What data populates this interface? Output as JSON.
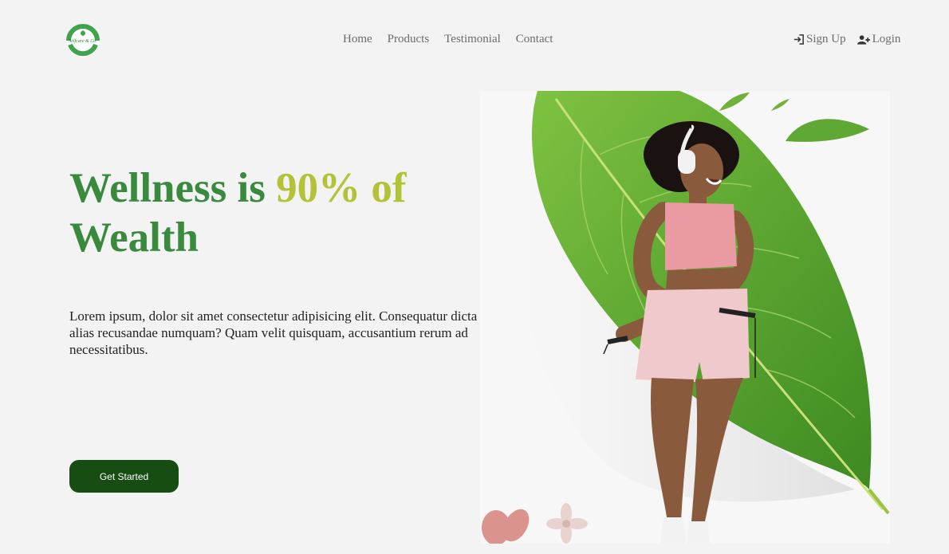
{
  "brand": {
    "logo_text": "Selfcare & Co.",
    "logo_icon": "leaf-badge-icon",
    "color_primary": "#3a8a3e",
    "color_accent": "#b3c236",
    "color_button": "#174d12"
  },
  "nav": {
    "items": [
      {
        "label": "Home"
      },
      {
        "label": "Products"
      },
      {
        "label": "Testimonial"
      },
      {
        "label": "Contact"
      }
    ]
  },
  "auth": {
    "signup_label": "Sign Up",
    "signup_icon": "sign-in-icon",
    "login_label": "Login",
    "login_icon": "user-plus-icon"
  },
  "hero": {
    "headline_part1": "Wellness is ",
    "headline_part2": "90% of",
    "headline_part3": "Wealth",
    "description": "Lorem ipsum, dolor sit amet consectetur adipisicing elit. Consequatur dicta alias recusandae numquam? Quam velit quisquam, accusantium rerum ad necessitatibus.",
    "cta_label": "Get Started"
  }
}
